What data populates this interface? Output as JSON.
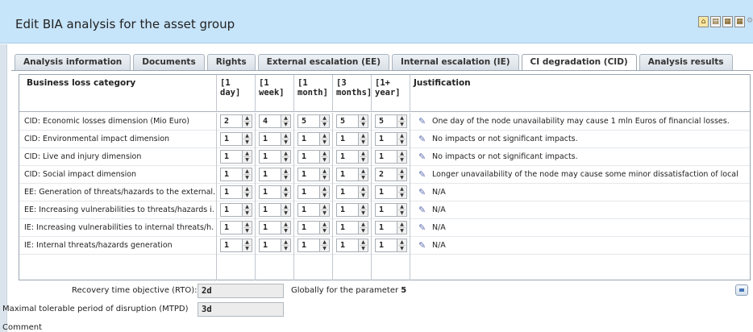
{
  "header": {
    "title": "Edit BIA analysis for the asset group",
    "icons": [
      "home-icon",
      "print-icon",
      "export-icon",
      "export-icon",
      "settings-icon"
    ]
  },
  "tabs": [
    {
      "label": "Analysis information",
      "active": false
    },
    {
      "label": "Documents",
      "active": false
    },
    {
      "label": "Rights",
      "active": false
    },
    {
      "label": "External escalation (EE)",
      "active": false
    },
    {
      "label": "Internal escalation (IE)",
      "active": false
    },
    {
      "label": "CI degradation (CID)",
      "active": true
    },
    {
      "label": "Analysis results",
      "active": false
    }
  ],
  "grid": {
    "headers": {
      "category": "Business loss category",
      "c1": "[1 day]",
      "c2": "[1 week]",
      "c3": "[1 month]",
      "c4": "[3 months]",
      "c5": "[1+ year]",
      "justification": "Justification"
    },
    "rows": [
      {
        "category": "CID: Economic losses dimension (Mio Euro)",
        "v": [
          "2",
          "4",
          "5",
          "5",
          "5"
        ],
        "justification": "One day of the node unavailability may cause 1 mln Euros of financial losses."
      },
      {
        "category": "CID: Environmental impact dimension",
        "v": [
          "1",
          "1",
          "1",
          "1",
          "1"
        ],
        "justification": "No impacts or not significant impacts."
      },
      {
        "category": "CID: Live and injury dimension",
        "v": [
          "1",
          "1",
          "1",
          "1",
          "1"
        ],
        "justification": "No impacts or not significant impacts."
      },
      {
        "category": "CID: Social impact dimension",
        "v": [
          "1",
          "1",
          "1",
          "1",
          "2"
        ],
        "justification": "Longer unavailability of the node may cause some minor dissatisfaction of local"
      },
      {
        "category": "EE: Generation of threats/hazards to the external...",
        "v": [
          "1",
          "1",
          "1",
          "1",
          "1"
        ],
        "justification": "N/A"
      },
      {
        "category": "EE: Increasing vulnerabilities to threats/hazards i...",
        "v": [
          "1",
          "1",
          "1",
          "1",
          "1"
        ],
        "justification": "N/A"
      },
      {
        "category": "IE: Increasing vulnerabilities to internal threats/h...",
        "v": [
          "1",
          "1",
          "1",
          "1",
          "1"
        ],
        "justification": "N/A"
      },
      {
        "category": "IE: Internal threats/hazards generation",
        "v": [
          "1",
          "1",
          "1",
          "1",
          "1"
        ],
        "justification": "N/A"
      }
    ]
  },
  "bottom": {
    "rto_label": "Recovery time objective (RTO):",
    "rto_value": "2d",
    "globally_text": "Globally for the parameter",
    "globally_value": "5",
    "mtpd_label": "Maximal tolerable period of disruption (MTPD)",
    "mtpd_value": "3d",
    "comment_label": "Comment"
  },
  "colors": {
    "header_bg": "#c6e4fa",
    "border": "#9aa6b2",
    "pencil": "#5b6fb0"
  }
}
